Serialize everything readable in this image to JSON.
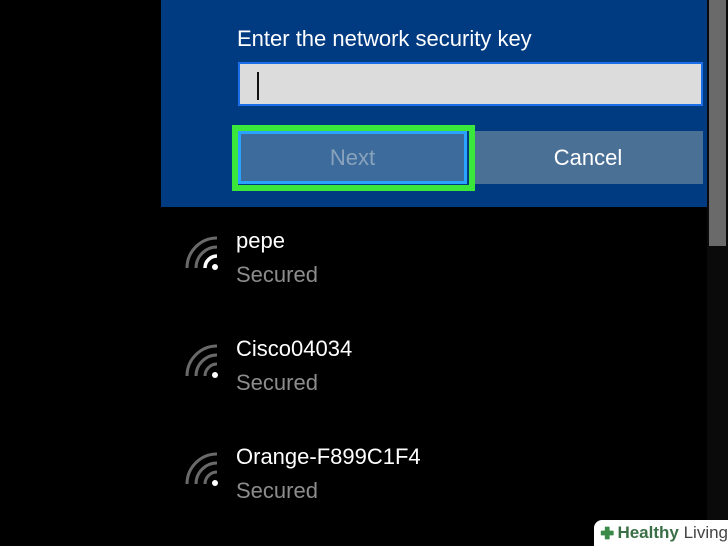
{
  "connect_panel": {
    "prompt_label": "Enter the network security key",
    "key_value": "",
    "next_label": "Next",
    "cancel_label": "Cancel"
  },
  "networks": [
    {
      "name": "pepe",
      "status": "Secured",
      "icon": "wifi-icon"
    },
    {
      "name": "Cisco04034",
      "status": "Secured",
      "icon": "wifi-icon"
    },
    {
      "name": "Orange-F899C1F4",
      "status": "Secured",
      "icon": "wifi-icon"
    }
  ],
  "watermark": {
    "bold": "Healthy",
    "light": " Living",
    "icon": "plus-icon"
  },
  "colors": {
    "panel": "#003b82",
    "highlight": "#39e83a",
    "input_border": "#1a6ee8",
    "secondary_text": "#8c8c8c"
  }
}
